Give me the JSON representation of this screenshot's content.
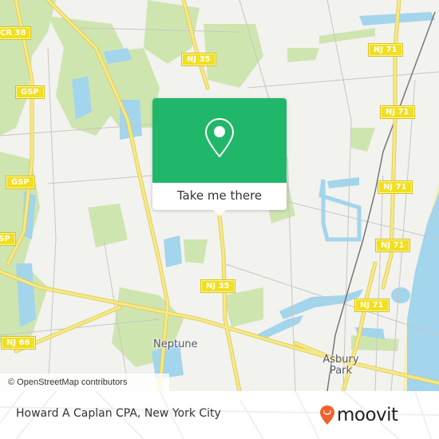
{
  "map": {
    "road_shields": [
      {
        "id": "cr38",
        "label": "CR 38"
      },
      {
        "id": "gsp-1",
        "label": "GSP"
      },
      {
        "id": "gsp-2",
        "label": "GSP"
      },
      {
        "id": "gsp-3",
        "label": "GSP"
      },
      {
        "id": "nj35-top",
        "label": "NJ 35"
      },
      {
        "id": "nj35-mid",
        "label": "NJ 35"
      },
      {
        "id": "nj66",
        "label": "NJ 66"
      },
      {
        "id": "nj71-1",
        "label": "NJ 71"
      },
      {
        "id": "nj71-2",
        "label": "NJ 71"
      },
      {
        "id": "nj71-3",
        "label": "NJ 71"
      },
      {
        "id": "nj71-4",
        "label": "NJ 71"
      },
      {
        "id": "nj71-5",
        "label": "NJ 71"
      }
    ],
    "places": [
      {
        "id": "neptune",
        "label": "Neptune"
      },
      {
        "id": "asbury-park",
        "label": "Asbury Park"
      }
    ],
    "attribution": "© OpenStreetMap contributors",
    "colors": {
      "land": "#f2f2ef",
      "park": "#cfe5b0",
      "water": "#a3d5ec",
      "highway": "#f5e27a",
      "popup_green": "#21b76a"
    }
  },
  "popup": {
    "icon": "map-pin-icon",
    "button_label": "Take me there"
  },
  "footer": {
    "title": "Howard A Caplan CPA, New York City",
    "brand": "moovit",
    "brand_color": "#f0612e"
  }
}
